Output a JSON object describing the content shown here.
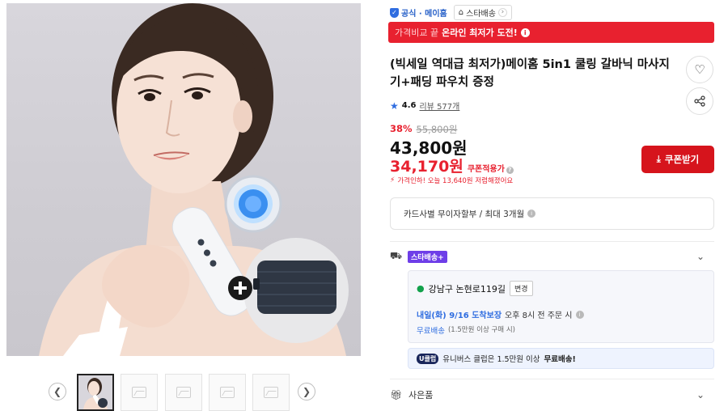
{
  "seller": {
    "official_label": "공식 · 메이홈",
    "store_label": "스타배송",
    "shield_icon": "shield-check-icon",
    "home_icon": "home-icon"
  },
  "promo_banner": {
    "prefix": "가격비교 끝",
    "highlight": "온라인 최저가 도전!",
    "info_icon": "info-icon",
    "color": "#e8212f"
  },
  "product": {
    "title": "(빅세일 역대급 최저가)메이홈 5in1 쿨링 갈바닉 마사지기+패딩 파우치 증정",
    "rating": "4.6",
    "reviews_label": "리뷰 577개",
    "discount_rate": "38%",
    "original_price": "55,800원",
    "price": "43,800원",
    "coupon_price": "34,170원",
    "coupon_label": "쿠폰적용가",
    "savings_text": "가격인하! 오늘 13,640원 저렴해졌어요"
  },
  "actions": {
    "wishlist_icon": "heart-icon",
    "share_icon": "share-icon",
    "coupon_button": "쿠폰받기",
    "coupon_button_color": "#d6141c"
  },
  "installment": {
    "text": "카드사별 무이자할부 / 최대 3개월"
  },
  "shipping": {
    "badge": "스타배송+",
    "address": "강남구 논현로119길",
    "change_button": "변경",
    "eta_highlight": "내일(화) 9/16 도착보장",
    "eta_rest": "오후 8시 전 주문 시",
    "free_label": "무료배송",
    "free_condition": "(1.5만원 이상 구매 시)"
  },
  "club": {
    "badge": "U클럽",
    "text_prefix": "유니버스 클럽은 1.5만원 이상",
    "text_bold": "무료배송!"
  },
  "gift": {
    "label": "사은품"
  },
  "gallery": {
    "prev_icon": "chevron-left-icon",
    "next_icon": "chevron-right-icon",
    "thumb_count": 5
  }
}
